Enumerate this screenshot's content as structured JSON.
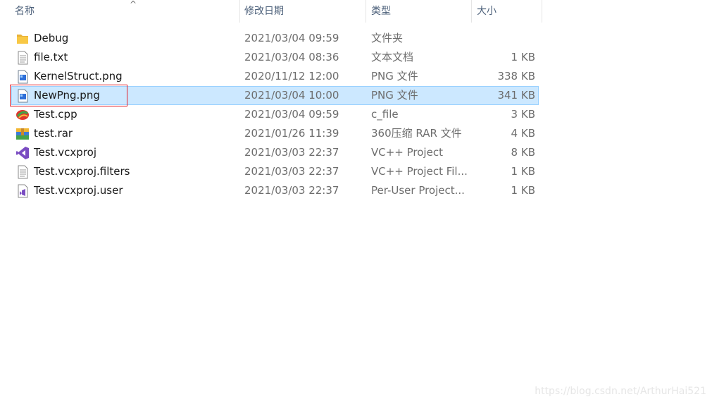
{
  "columns": {
    "name": "名称",
    "date": "修改日期",
    "type": "类型",
    "size": "大小",
    "sort_indicator": "^"
  },
  "files": [
    {
      "name": "Debug",
      "date": "2021/03/04 09:59",
      "type": "文件夹",
      "size": "",
      "icon": "folder-icon"
    },
    {
      "name": "file.txt",
      "date": "2021/03/04 08:36",
      "type": "文本文档",
      "size": "1 KB",
      "icon": "text-file-icon"
    },
    {
      "name": "KernelStruct.png",
      "date": "2020/11/12 12:00",
      "type": "PNG 文件",
      "size": "338 KB",
      "icon": "image-file-icon"
    },
    {
      "name": "NewPng.png",
      "date": "2021/03/04 10:00",
      "type": "PNG 文件",
      "size": "341 KB",
      "icon": "image-file-icon"
    },
    {
      "name": "Test.cpp",
      "date": "2021/03/04 09:59",
      "type": "c_file",
      "size": "3 KB",
      "icon": "cpp-file-icon"
    },
    {
      "name": "test.rar",
      "date": "2021/01/26 11:39",
      "type": "360压缩 RAR 文件",
      "size": "4 KB",
      "icon": "rar-archive-icon"
    },
    {
      "name": "Test.vcxproj",
      "date": "2021/03/03 22:37",
      "type": "VC++ Project",
      "size": "8 KB",
      "icon": "visual-studio-project-icon"
    },
    {
      "name": "Test.vcxproj.filters",
      "date": "2021/03/03 22:37",
      "type": "VC++ Project Fil...",
      "size": "1 KB",
      "icon": "generic-file-icon"
    },
    {
      "name": "Test.vcxproj.user",
      "date": "2021/03/03 22:37",
      "type": "Per-User Project...",
      "size": "1 KB",
      "icon": "vs-user-file-icon"
    }
  ],
  "selected_file": "NewPng.png",
  "colors": {
    "selection": "#cce8ff",
    "selection_border": "#99d1ff",
    "highlight_box": "#e0202a",
    "folder": "#f8c845"
  },
  "watermark": "https://blog.csdn.net/ArthurHai521"
}
